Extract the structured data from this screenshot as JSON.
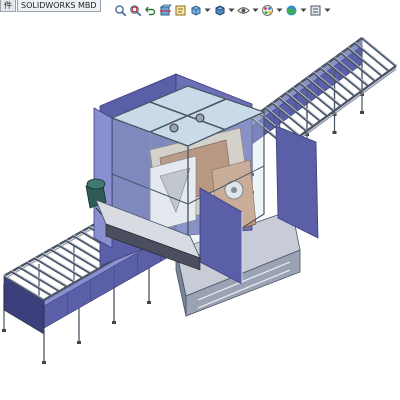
{
  "window": {
    "background": "#ffffff"
  },
  "command_manager": {
    "tabs": [
      {
        "label": "件"
      },
      {
        "label": "SOLIDWORKS MBD"
      }
    ]
  },
  "heads_up_toolbar": {
    "buttons": [
      {
        "icon": "zoom-to-fit-icon"
      },
      {
        "icon": "zoom-to-area-icon"
      },
      {
        "icon": "previous-view-icon"
      },
      {
        "icon": "section-view-icon"
      },
      {
        "icon": "dynamic-annotation-views-icon"
      },
      {
        "icon": "view-orientation-icon"
      },
      {
        "icon": "display-style-icon"
      },
      {
        "icon": "hide-show-items-icon"
      },
      {
        "icon": "edit-appearance-icon"
      },
      {
        "icon": "apply-scene-icon"
      },
      {
        "icon": "view-settings-icon"
      }
    ]
  },
  "model": {
    "name": "conveyor-assembly-with-enclosure",
    "colors": {
      "body": "#5a5fa8",
      "body_dark": "#3b3f7c",
      "body_light": "#8a8fd0",
      "frame": "#8b97a8",
      "frame_dark": "#4a5566",
      "glass": "#c9dbe9",
      "copper": "#b07a58",
      "motor": "#2f5b55"
    }
  }
}
